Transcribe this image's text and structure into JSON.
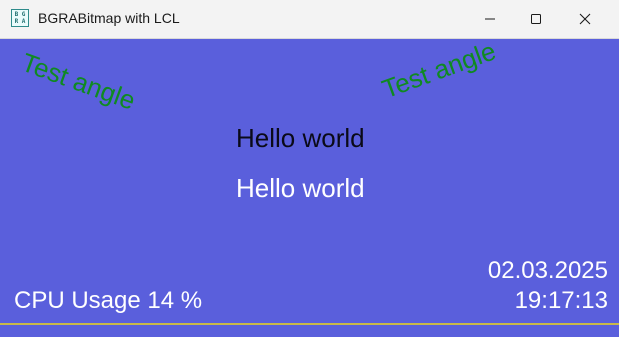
{
  "window": {
    "title": "BGRABitmap with LCL",
    "icon_name": "bgra-app-icon",
    "icon_letters": [
      "B G",
      "R A"
    ]
  },
  "controls": {
    "minimize": "minimize-icon",
    "maximize": "maximize-icon",
    "close": "close-icon"
  },
  "canvas": {
    "background": "#5a5fdc",
    "angle_text_left": "Test angle",
    "angle_text_right": "Test angle",
    "hello_black": "Hello world",
    "hello_white": "Hello world",
    "cpu_usage": "CPU Usage 14 %",
    "date": "02.03.2025",
    "time": "19:17:13",
    "colors": {
      "angle_text": "#0f8a21",
      "hello_black": "#0a0a18",
      "white_text": "#ffffff"
    }
  }
}
